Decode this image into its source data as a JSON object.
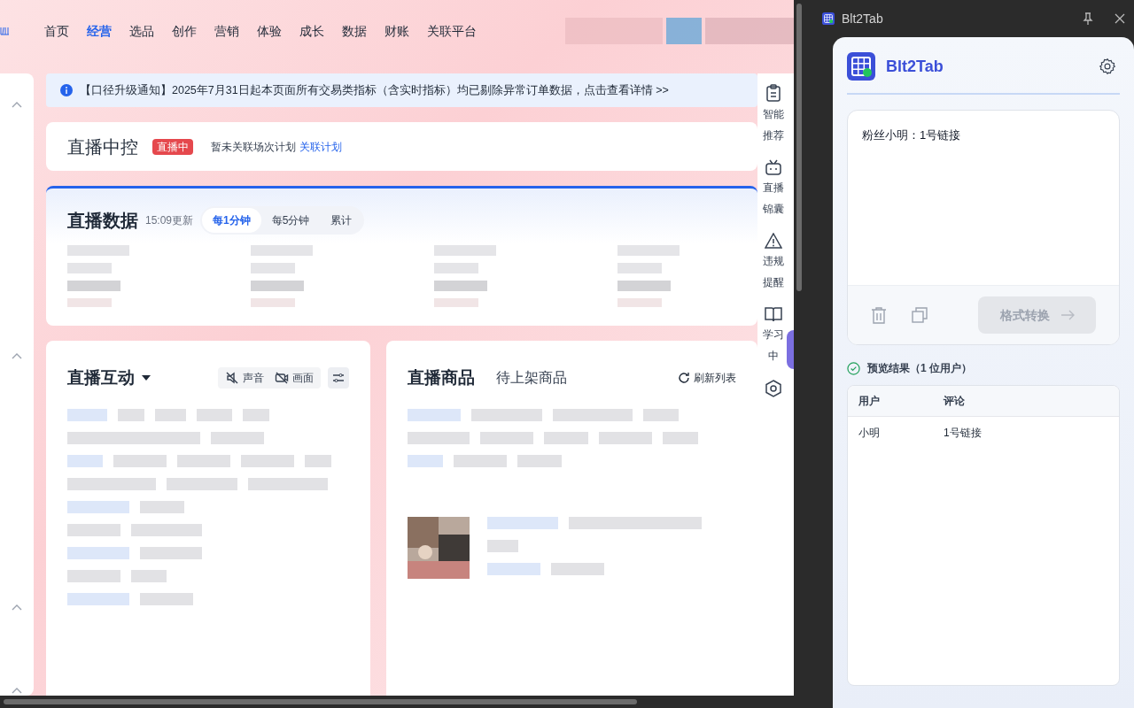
{
  "nav": {
    "items": [
      {
        "label": "首页",
        "selected": false
      },
      {
        "label": "经营",
        "selected": true
      },
      {
        "label": "选品",
        "selected": false
      },
      {
        "label": "创作",
        "selected": false
      },
      {
        "label": "营销",
        "selected": false
      },
      {
        "label": "体验",
        "selected": false
      },
      {
        "label": "成长",
        "selected": false
      },
      {
        "label": "数据",
        "selected": false
      },
      {
        "label": "财账",
        "selected": false
      },
      {
        "label": "关联平台",
        "selected": false
      }
    ]
  },
  "notice": {
    "text": "【口径升级通知】2025年7月31日起本页面所有交易类指标（含实时指标）均已剔除异常订单数据，点击查看详情 >>"
  },
  "live_control": {
    "title": "直播中控",
    "badge": "直播中",
    "plan_text": "暂未关联场次计划",
    "plan_link": "关联计划"
  },
  "live_data": {
    "title": "直播数据",
    "updated": "15:09更新",
    "tabs": [
      {
        "label": "每1分钟",
        "selected": true
      },
      {
        "label": "每5分钟",
        "selected": false
      },
      {
        "label": "累计",
        "selected": false
      }
    ]
  },
  "interaction": {
    "title": "直播互动",
    "toggles": [
      {
        "kind": "sound",
        "label": "声音",
        "on": false
      },
      {
        "kind": "video",
        "label": "画面",
        "on": false
      }
    ]
  },
  "products": {
    "title": "直播商品",
    "tab": "待上架商品",
    "refresh": "刷新列表"
  },
  "side_rail": {
    "items": [
      {
        "kind": "clipboard",
        "lines": [
          "智能",
          "推荐"
        ]
      },
      {
        "kind": "robot",
        "lines": [
          "直播",
          "锦囊"
        ]
      },
      {
        "kind": "warning",
        "lines": [
          "违规",
          "提醒"
        ]
      },
      {
        "kind": "book",
        "lines": [
          "学习",
          "中"
        ]
      },
      {
        "kind": "hexagon"
      }
    ]
  },
  "plugin": {
    "window_title": "Blt2Tab",
    "app_name": "Blt2Tab",
    "input_text": "粉丝小明：1号链接",
    "convert_button": {
      "label": "格式转换",
      "disabled": true
    },
    "preview": {
      "label": "预览结果（1 位用户）",
      "columns": [
        "用户",
        "评论"
      ],
      "rows": [
        [
          "小明",
          "1号链接"
        ]
      ]
    }
  }
}
